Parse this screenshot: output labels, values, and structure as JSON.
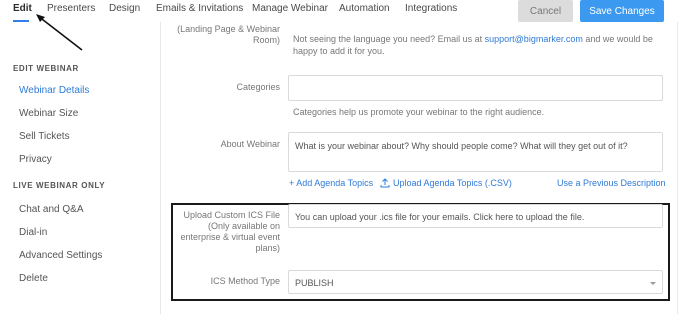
{
  "topnav": {
    "tabs": [
      "Edit",
      "Presenters",
      "Design",
      "Emails & Invitations",
      "Manage Webinar",
      "Automation",
      "Integrations"
    ],
    "cancel_label": "Cancel",
    "save_label": "Save Changes"
  },
  "sidebar": {
    "section1": "EDIT WEBINAR",
    "items1": [
      "Webinar Details",
      "Webinar Size",
      "Sell Tickets",
      "Privacy"
    ],
    "section2": "LIVE WEBINAR ONLY",
    "items2": [
      "Chat and Q&A",
      "Dial-in",
      "Advanced Settings",
      "Delete"
    ]
  },
  "form": {
    "language_label_1": "(Landing Page & Webinar",
    "language_label_2": "Room)",
    "language_help_1": "Not seeing the language you need? Email us at",
    "language_help_email": "support@bigmarker.com",
    "language_help_2": "and we would be",
    "language_help_3": "happy to add it for you.",
    "categories_label": "Categories",
    "categories_value": "",
    "categories_help": "Categories help us promote your webinar to the right audience.",
    "about_label": "About Webinar",
    "about_placeholder": "What is your webinar about? Why should people come? What will they get out of it?",
    "add_agenda": "+ Add Agenda Topics",
    "upload_agenda": "Upload Agenda Topics (.CSV)",
    "previous_description": "Use a Previous Description",
    "ics_label_1": "Upload Custom ICS File",
    "ics_label_2": "(Only available on",
    "ics_label_3": "enterprise & virtual event",
    "ics_label_4": "plans)",
    "ics_value": "You can upload your .ics file for your emails. Click here to upload the file.",
    "ics_method_label": "ICS Method Type",
    "ics_method_value": "PUBLISH"
  }
}
